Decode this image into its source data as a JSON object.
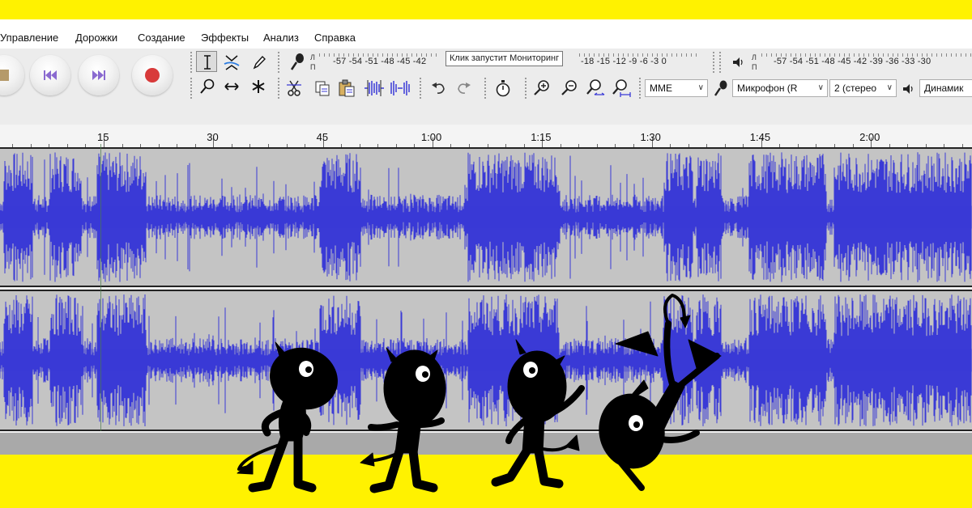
{
  "menu": [
    "Управление",
    "Дорожки",
    "Создание",
    "Эффекты",
    "Анализ",
    "Справка"
  ],
  "record_meter": {
    "left_label": "Л",
    "right_label": "П",
    "scale": "-57 -54 -51 -48 -45 -42",
    "scale_tail": "-18 -15 -12 -9 -6 -3 0",
    "tooltip": "Клик запустит Мониторинг"
  },
  "playback_meter": {
    "left_label": "Л",
    "right_label": "П",
    "scale": "-57 -54 -51 -48 -45 -42 -39 -36 -33 -30"
  },
  "device_toolbar": {
    "host": "MME",
    "input_device": "Микрофон (R",
    "channels": "2 (стерео",
    "output_device": "Динамик"
  },
  "timeline": {
    "labels": [
      "15",
      "30",
      "45",
      "1:00",
      "1:15",
      "1:30",
      "1:45",
      "2:00"
    ]
  },
  "icons": {
    "transport": [
      "pause-icon",
      "skip-to-start-icon",
      "skip-to-end-icon",
      "record-icon"
    ],
    "tools": [
      "selection-tool-icon",
      "envelope-tool-icon",
      "draw-tool-icon",
      "zoom-tool-icon",
      "time-shift-tool-icon",
      "multi-tool-icon"
    ],
    "edit": [
      "cut-icon",
      "copy-icon",
      "paste-icon",
      "trim-icon",
      "silence-icon",
      "undo-icon",
      "redo-icon",
      "sync-lock-icon",
      "zoom-in-icon",
      "zoom-out-icon",
      "fit-selection-icon",
      "fit-project-icon"
    ]
  },
  "colors": {
    "waveform": "#3a3ad6",
    "track_bg": "#c4c4c4",
    "banner": "#fff200",
    "record": "#d83a3a",
    "transport_accent": "#8a6ad0"
  }
}
